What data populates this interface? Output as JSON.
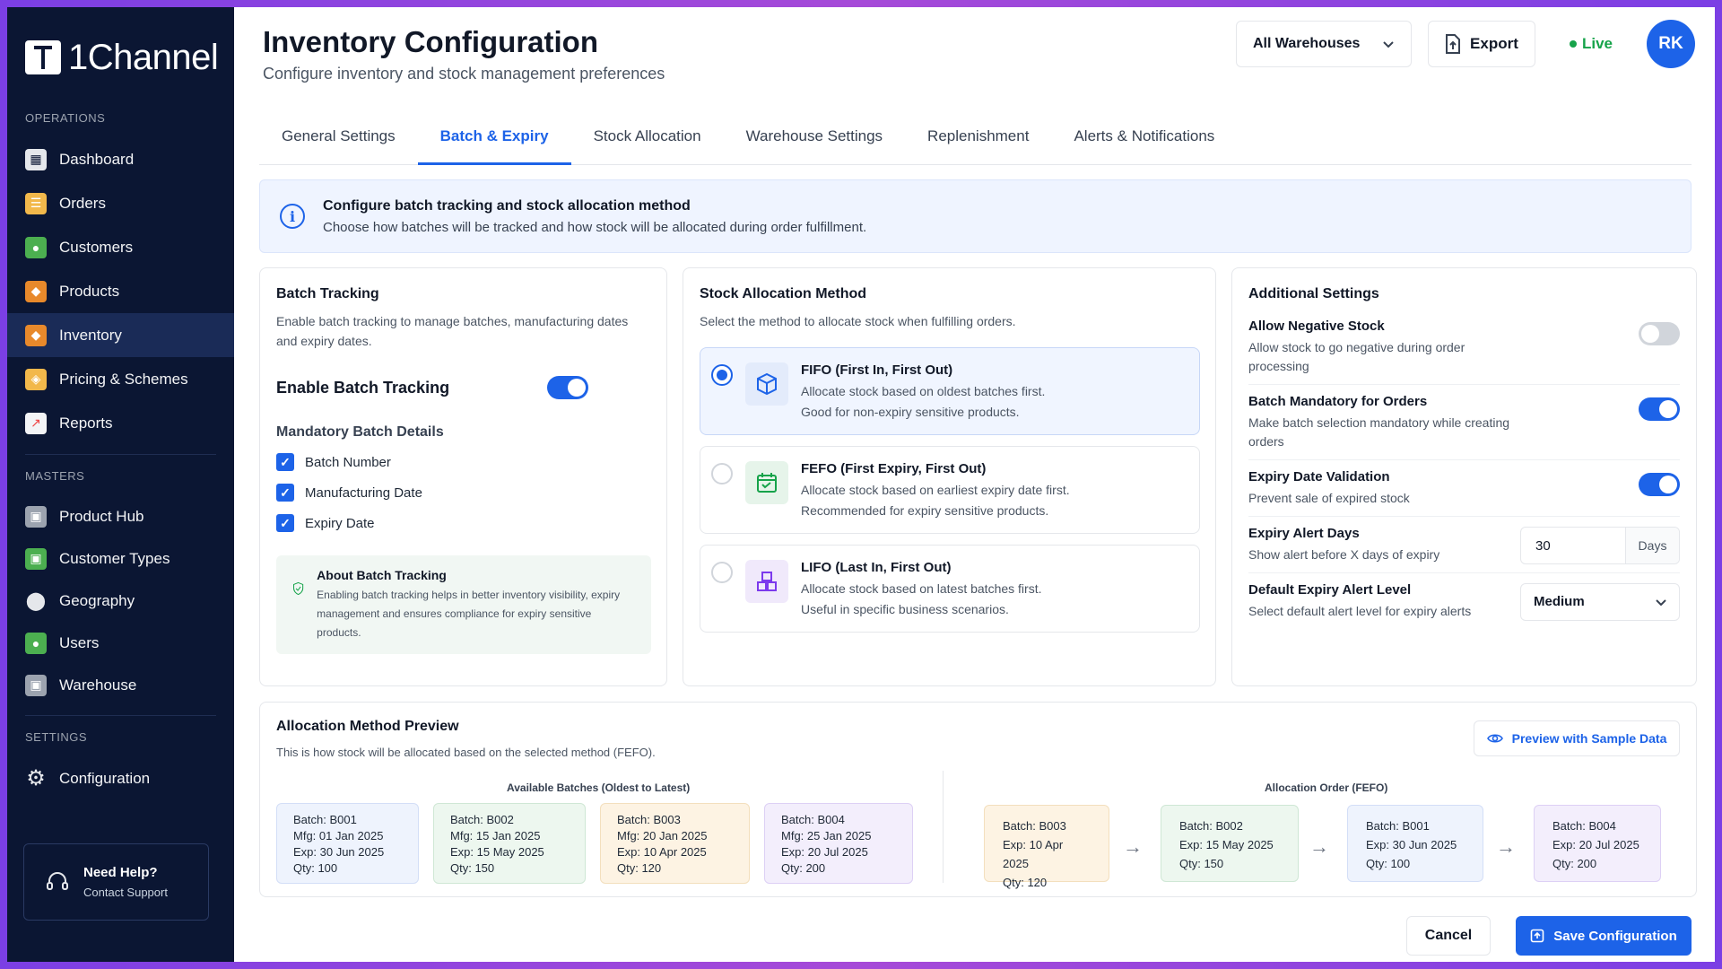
{
  "brand": {
    "name": "1Channel"
  },
  "sidebar": {
    "sections": [
      {
        "label": "OPERATIONS",
        "items": [
          {
            "label": "Dashboard",
            "icon": "dashboard-icon",
            "color": "#e5e7eb"
          },
          {
            "label": "Orders",
            "icon": "clipboard-icon",
            "color": "#f2b84b"
          },
          {
            "label": "Customers",
            "icon": "customers-icon",
            "color": "#4caf50"
          },
          {
            "label": "Products",
            "icon": "box-icon",
            "color": "#e8892b"
          },
          {
            "label": "Inventory",
            "icon": "inventory-icon",
            "color": "#e8892b",
            "active": true
          },
          {
            "label": "Pricing & Schemes",
            "icon": "tag-icon",
            "color": "#f2b84b"
          },
          {
            "label": "Reports",
            "icon": "chart-icon",
            "color": "#ef4444"
          }
        ]
      },
      {
        "label": "MASTERS",
        "items": [
          {
            "label": "Product Hub",
            "icon": "hub-icon",
            "color": "#9ca3af"
          },
          {
            "label": "Customer Types",
            "icon": "customer-types-icon",
            "color": "#4caf50"
          },
          {
            "label": "Geography",
            "icon": "location-pin-icon",
            "color": "#e5e7eb"
          },
          {
            "label": "Users",
            "icon": "user-icon",
            "color": "#4caf50"
          },
          {
            "label": "Warehouse",
            "icon": "warehouse-icon",
            "color": "#9ca3af"
          }
        ]
      },
      {
        "label": "SETTINGS",
        "items": [
          {
            "label": "Configuration",
            "icon": "gear-icon",
            "color": "#e5e7eb"
          }
        ]
      }
    ],
    "help": {
      "title": "Need Help?",
      "subtitle": "Contact Support"
    }
  },
  "header": {
    "title": "Inventory Configuration",
    "subtitle": "Configure inventory and stock management preferences",
    "warehouse_select": "All Warehouses",
    "export_label": "Export",
    "status": "Live",
    "avatar_initials": "RK"
  },
  "tabs": [
    {
      "label": "General Settings",
      "active": false
    },
    {
      "label": "Batch & Expiry",
      "active": true
    },
    {
      "label": "Stock Allocation",
      "active": false
    },
    {
      "label": "Warehouse Settings",
      "active": false
    },
    {
      "label": "Replenishment",
      "active": false
    },
    {
      "label": "Alerts & Notifications",
      "active": false
    }
  ],
  "info": {
    "title": "Configure batch tracking and stock allocation method",
    "subtitle": "Choose how batches will be tracked and how stock will be allocated during order fulfillment."
  },
  "batch_tracking": {
    "title": "Batch Tracking",
    "description": "Enable batch tracking to manage batches, manufacturing dates and expiry dates.",
    "enable_label": "Enable Batch Tracking",
    "enabled": true,
    "mandatory_title": "Mandatory Batch Details",
    "mandatory_items": [
      {
        "label": "Batch Number",
        "checked": true
      },
      {
        "label": "Manufacturing Date",
        "checked": true
      },
      {
        "label": "Expiry Date",
        "checked": true
      }
    ],
    "about_title": "About Batch Tracking",
    "about_text": "Enabling batch tracking helps in better inventory visibility, expiry management and ensures compliance for expiry sensitive products."
  },
  "allocation": {
    "title": "Stock Allocation Method",
    "description": "Select the method to allocate stock when fulfilling orders.",
    "methods": [
      {
        "title": "FIFO (First In, First Out)",
        "line1": "Allocate stock based on oldest batches first.",
        "line2": "Good for non-expiry sensitive products.",
        "selected": true,
        "icon": "cube-icon"
      },
      {
        "title": "FEFO (First Expiry, First Out)",
        "line1": "Allocate stock based on earliest expiry date first.",
        "line2": "Recommended for expiry sensitive products.",
        "selected": false,
        "icon": "calendar-icon"
      },
      {
        "title": "LIFO (Last In, First Out)",
        "line1": "Allocate stock based on latest batches first.",
        "line2": "Useful in specific business scenarios.",
        "selected": false,
        "icon": "stacked-boxes-icon"
      }
    ]
  },
  "additional": {
    "title": "Additional Settings",
    "negative_stock": {
      "title": "Allow Negative Stock",
      "desc": "Allow stock to go negative during order processing",
      "enabled": false
    },
    "batch_mandatory": {
      "title": "Batch Mandatory for Orders",
      "desc": "Make batch selection mandatory while creating orders",
      "enabled": true
    },
    "expiry_validation": {
      "title": "Expiry Date Validation",
      "desc": "Prevent sale of expired stock",
      "enabled": true
    },
    "alert_days": {
      "title": "Expiry Alert Days",
      "desc": "Show alert before X days of expiry",
      "value": "30",
      "unit": "Days"
    },
    "alert_level": {
      "title": "Default Expiry Alert Level",
      "desc": "Select default alert level for expiry alerts",
      "value": "Medium"
    }
  },
  "preview": {
    "title": "Allocation Method Preview",
    "subtitle": "This is how stock will be allocated based on the selected method (FEFO).",
    "button_label": "Preview with Sample Data",
    "available_heading": "Available Batches (Oldest to Latest)",
    "order_heading": "Allocation Order (FEFO)",
    "available": [
      {
        "batch": "Batch: B001",
        "mfg": "Mfg: 01 Jan 2025",
        "exp": "Exp: 30 Jun 2025",
        "qty": "Qty: 100",
        "color": "blue"
      },
      {
        "batch": "Batch: B002",
        "mfg": "Mfg: 15 Jan 2025",
        "exp": "Exp: 15 May 2025",
        "qty": "Qty: 150",
        "color": "green"
      },
      {
        "batch": "Batch: B003",
        "mfg": "Mfg: 20 Jan 2025",
        "exp": "Exp: 10 Apr 2025",
        "qty": "Qty: 120",
        "color": "orange"
      },
      {
        "batch": "Batch: B004",
        "mfg": "Mfg: 25 Jan 2025",
        "exp": "Exp: 20 Jul 2025",
        "qty": "Qty: 200",
        "color": "purple"
      }
    ],
    "order": [
      {
        "batch": "Batch: B003",
        "exp": "Exp: 10 Apr 2025",
        "qty": "Qty: 120",
        "color": "orange"
      },
      {
        "batch": "Batch: B002",
        "exp": "Exp: 15 May 2025",
        "qty": "Qty: 150",
        "color": "green"
      },
      {
        "batch": "Batch: B001",
        "exp": "Exp: 30 Jun 2025",
        "qty": "Qty: 100",
        "color": "blue"
      },
      {
        "batch": "Batch: B004",
        "exp": "Exp: 20 Jul 2025",
        "qty": "Qty: 200",
        "color": "purple"
      }
    ]
  },
  "footer": {
    "cancel_label": "Cancel",
    "save_label": "Save Configuration"
  },
  "colors": {
    "accent": "#1d63e8",
    "sidebar_bg": "#0b1633",
    "live": "#16a34a"
  }
}
